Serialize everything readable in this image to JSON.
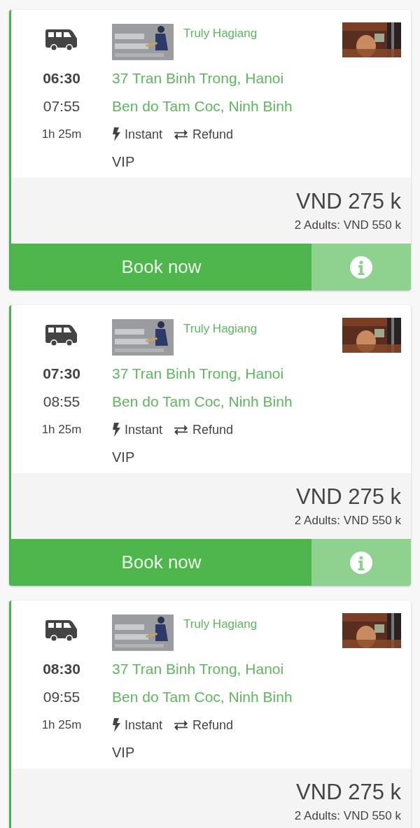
{
  "cards": [
    {
      "depart": "06:30",
      "arrive": "07:55",
      "duration": "1h 25m",
      "operator": "Truly Hagiang",
      "from": "37 Tran Binh Trong, Hanoi",
      "to": "Ben do Tam Coc, Ninh Binh",
      "features": [
        {
          "kind": "instant",
          "label": "Instant"
        },
        {
          "kind": "refund",
          "label": "Refund"
        }
      ],
      "class": "VIP",
      "price": "VND 275 k",
      "total": "2 Adults: VND 550 k",
      "book_label": "Book now"
    },
    {
      "depart": "07:30",
      "arrive": "08:55",
      "duration": "1h 25m",
      "operator": "Truly Hagiang",
      "from": "37 Tran Binh Trong, Hanoi",
      "to": "Ben do Tam Coc, Ninh Binh",
      "features": [
        {
          "kind": "instant",
          "label": "Instant"
        },
        {
          "kind": "refund",
          "label": "Refund"
        }
      ],
      "class": "VIP",
      "price": "VND 275 k",
      "total": "2 Adults: VND 550 k",
      "book_label": "Book now"
    },
    {
      "depart": "08:30",
      "arrive": "09:55",
      "duration": "1h 25m",
      "operator": "Truly Hagiang",
      "from": "37 Tran Binh Trong, Hanoi",
      "to": "Ben do Tam Coc, Ninh Binh",
      "features": [
        {
          "kind": "instant",
          "label": "Instant"
        },
        {
          "kind": "refund",
          "label": "Refund"
        }
      ],
      "class": "VIP",
      "price": "VND 275 k",
      "total": "2 Adults: VND 550 k"
    }
  ]
}
